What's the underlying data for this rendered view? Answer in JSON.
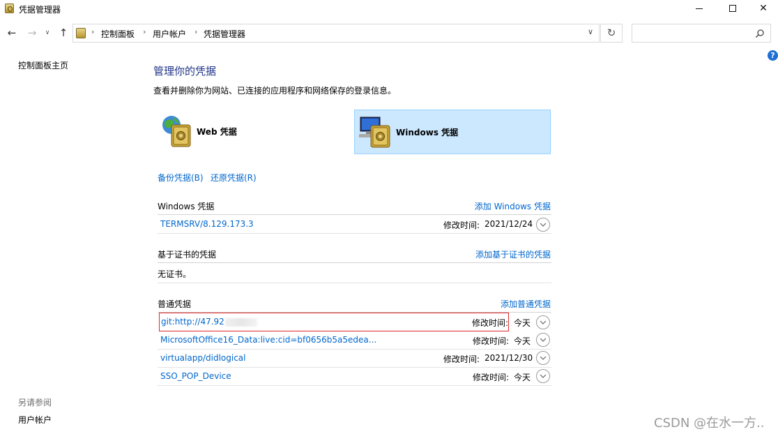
{
  "window": {
    "title": "凭据管理器"
  },
  "address": {
    "crumbs": [
      "控制面板",
      "用户帐户",
      "凭据管理器"
    ],
    "search_placeholder": ""
  },
  "left": {
    "home_link": "控制面板主页",
    "see_also": "另请参阅",
    "user_accounts": "用户帐户"
  },
  "main": {
    "heading": "管理你的凭据",
    "description": "查看并删除你为网站、已连接的应用程序和网络保存的登录信息。",
    "types": {
      "web": "Web 凭据",
      "windows": "Windows 凭据",
      "selected": "windows"
    },
    "backup": "备份凭据(B)",
    "restore": "还原凭据(R)",
    "windows_section": {
      "title": "Windows 凭据",
      "add": "添加 Windows 凭据",
      "items": [
        {
          "name": "TERMSRV/8.129.173.3",
          "modified_label": "修改时间:",
          "modified": "2021/12/24"
        }
      ]
    },
    "cert_section": {
      "title": "基于证书的凭据",
      "add": "添加基于证书的凭据",
      "empty": "无证书。"
    },
    "generic_section": {
      "title": "普通凭据",
      "add": "添加普通凭据",
      "items": [
        {
          "name": "git:http://47.92",
          "modified_label": "修改时间:",
          "modified": "今天"
        },
        {
          "name": "MicrosoftOffice16_Data:live:cid=bf0656b5a5edea...",
          "modified_label": "修改时间:",
          "modified": "今天"
        },
        {
          "name": "virtualapp/didlogical",
          "modified_label": "修改时间:",
          "modified": "2021/12/30"
        },
        {
          "name": "SSO_POP_Device",
          "modified_label": "修改时间:",
          "modified": "今天"
        }
      ]
    }
  },
  "watermark": "CSDN @在水一方..",
  "colors": {
    "link": "#0066cc",
    "heading": "#1e3287",
    "selected_bg": "#cce8ff",
    "highlight_border": "#e0262b"
  }
}
